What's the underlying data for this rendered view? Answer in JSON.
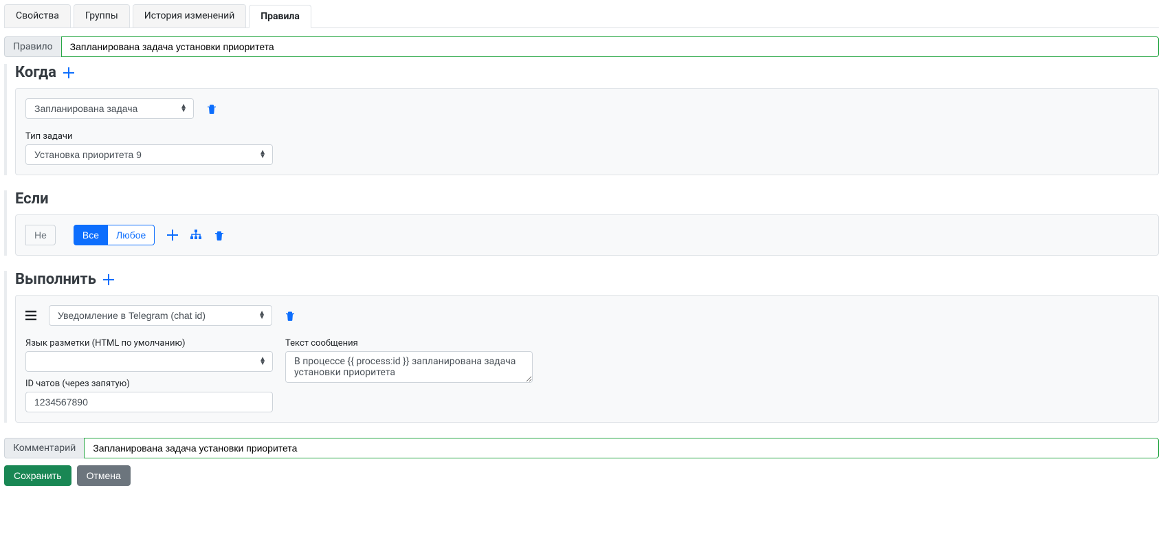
{
  "tabs": {
    "properties": "Свойства",
    "groups": "Группы",
    "history": "История изменений",
    "rules": "Правила"
  },
  "rule": {
    "label": "Правило",
    "value": "Запланирована задача установки приоритета"
  },
  "when": {
    "title": "Когда",
    "trigger_select": "Запланирована задача",
    "task_type_label": "Тип задачи",
    "task_type_value": "Установка приоритета 9"
  },
  "if": {
    "title": "Если",
    "not": "Не",
    "all": "Все",
    "any": "Любое"
  },
  "execute": {
    "title": "Выполнить",
    "action_select": "Уведомление в Telegram (chat id)",
    "markup_label": "Язык разметки (HTML по умолчанию)",
    "markup_value": "",
    "chat_ids_label": "ID чатов (через запятую)",
    "chat_ids_value": "1234567890",
    "message_label": "Текст сообщения",
    "message_value": "В процессе {{ process:id }} запланирована задача установки приоритета"
  },
  "comment": {
    "label": "Комментарий",
    "value": "Запланирована задача установки приоритета"
  },
  "buttons": {
    "save": "Сохранить",
    "cancel": "Отмена"
  }
}
